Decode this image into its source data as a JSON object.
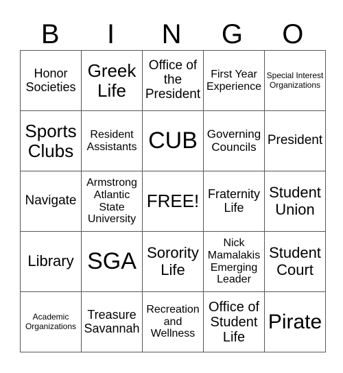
{
  "header": {
    "letters": [
      "B",
      "I",
      "N",
      "G",
      "O"
    ]
  },
  "rows": [
    [
      "Honor Societies",
      "Greek Life",
      "Office of the President",
      "First Year Experience",
      "Special Interest Organizations"
    ],
    [
      "Sports Clubs",
      "Resident Assistants",
      "CUB",
      "Governing Councils",
      "President"
    ],
    [
      "Navigate",
      "Armstrong Atlantic State University",
      "FREE!",
      "Fraternity Life",
      "Student Union"
    ],
    [
      "Library",
      "SGA",
      "Sorority Life",
      "Nick Mamalakis Emerging Leader",
      "Student Court"
    ],
    [
      "Academic Organizations",
      "Treasure Savannah",
      "Recreation and Wellness",
      "Office of Student Life",
      "Pirate"
    ]
  ]
}
